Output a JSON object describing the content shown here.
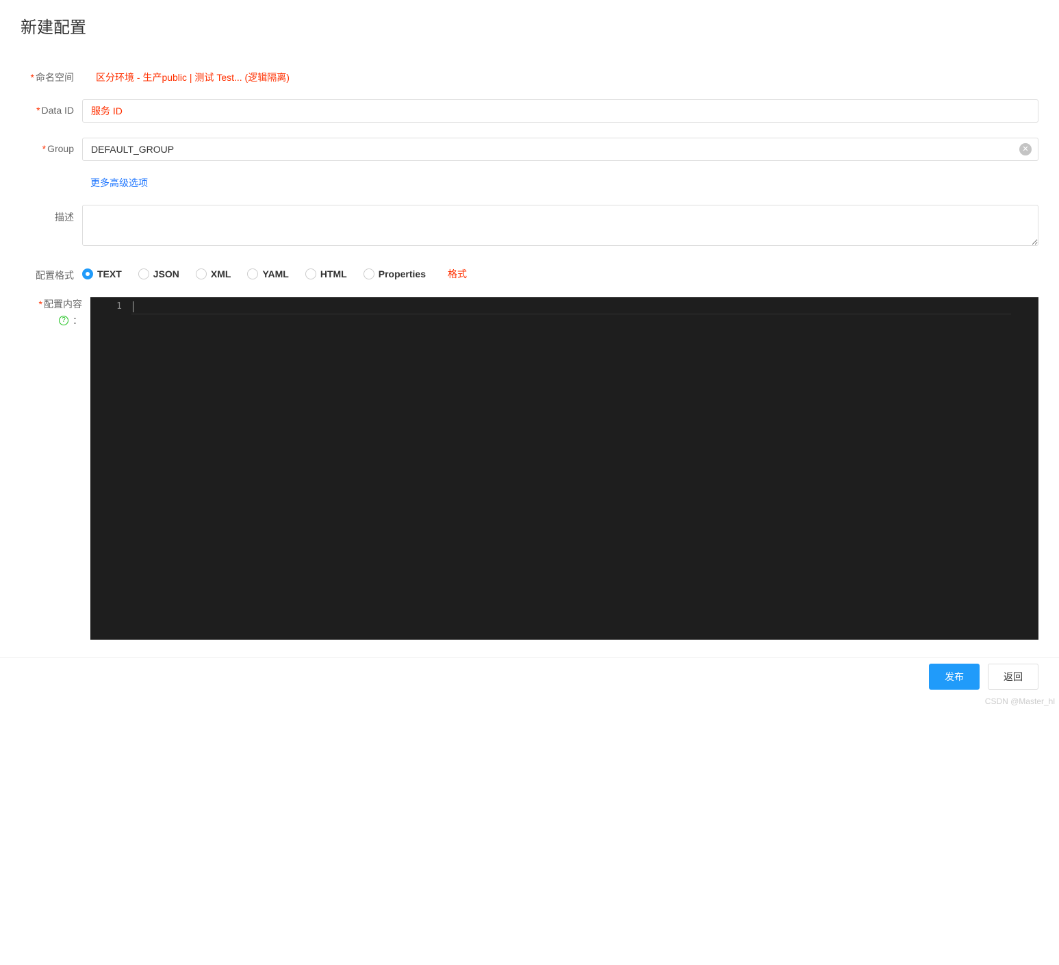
{
  "page": {
    "title": "新建配置"
  },
  "form": {
    "namespace": {
      "label": "命名空间",
      "annotation": "区分环境 - 生产public | 测试 Test... (逻辑隔离)"
    },
    "data_id": {
      "label": "Data ID",
      "placeholder": "服务 ID",
      "value": ""
    },
    "group": {
      "label": "Group",
      "value": "DEFAULT_GROUP"
    },
    "more_options": "更多高级选项",
    "description": {
      "label": "描述",
      "value": ""
    },
    "format": {
      "label": "配置格式",
      "options": [
        "TEXT",
        "JSON",
        "XML",
        "YAML",
        "HTML",
        "Properties"
      ],
      "selected": "TEXT",
      "annotation": "格式"
    },
    "content": {
      "label": "配置内容",
      "line_number": "1",
      "value": ""
    }
  },
  "footer": {
    "publish": "发布",
    "back": "返回"
  },
  "watermark": "CSDN @Master_hl"
}
